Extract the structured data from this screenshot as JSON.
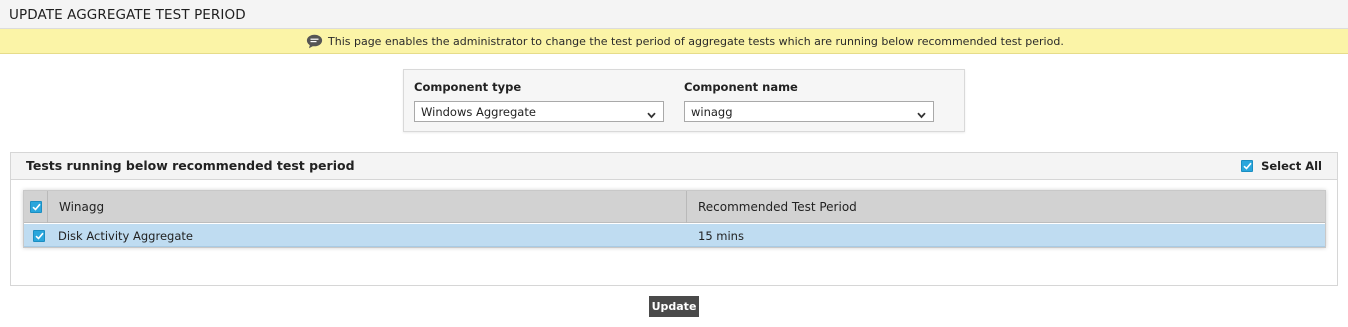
{
  "header": {
    "title": "UPDATE AGGREGATE TEST PERIOD"
  },
  "info_bar": {
    "icon": "comment-icon",
    "message": "This page enables the administrator to change the test period of aggregate tests which are running below recommended test period."
  },
  "filters": {
    "component_type": {
      "label": "Component type",
      "value": "Windows Aggregate"
    },
    "component_name": {
      "label": "Component name",
      "value": "winagg"
    }
  },
  "tests_panel": {
    "title": "Tests running below recommended test period",
    "select_all": {
      "label": "Select All",
      "checked": true
    },
    "table": {
      "columns": [
        "Winagg",
        "Recommended Test Period"
      ],
      "header_checked": true,
      "rows": [
        {
          "checked": true,
          "test": "Disk Activity Aggregate",
          "period": "15 mins"
        }
      ]
    }
  },
  "actions": {
    "update_label": "Update"
  },
  "colors": {
    "accent_checkbox": "#2aa6dc",
    "info_bar_bg": "#fbf4a7",
    "selected_row_bg": "#bfdcf1",
    "button_bg": "#4a4a4a"
  }
}
